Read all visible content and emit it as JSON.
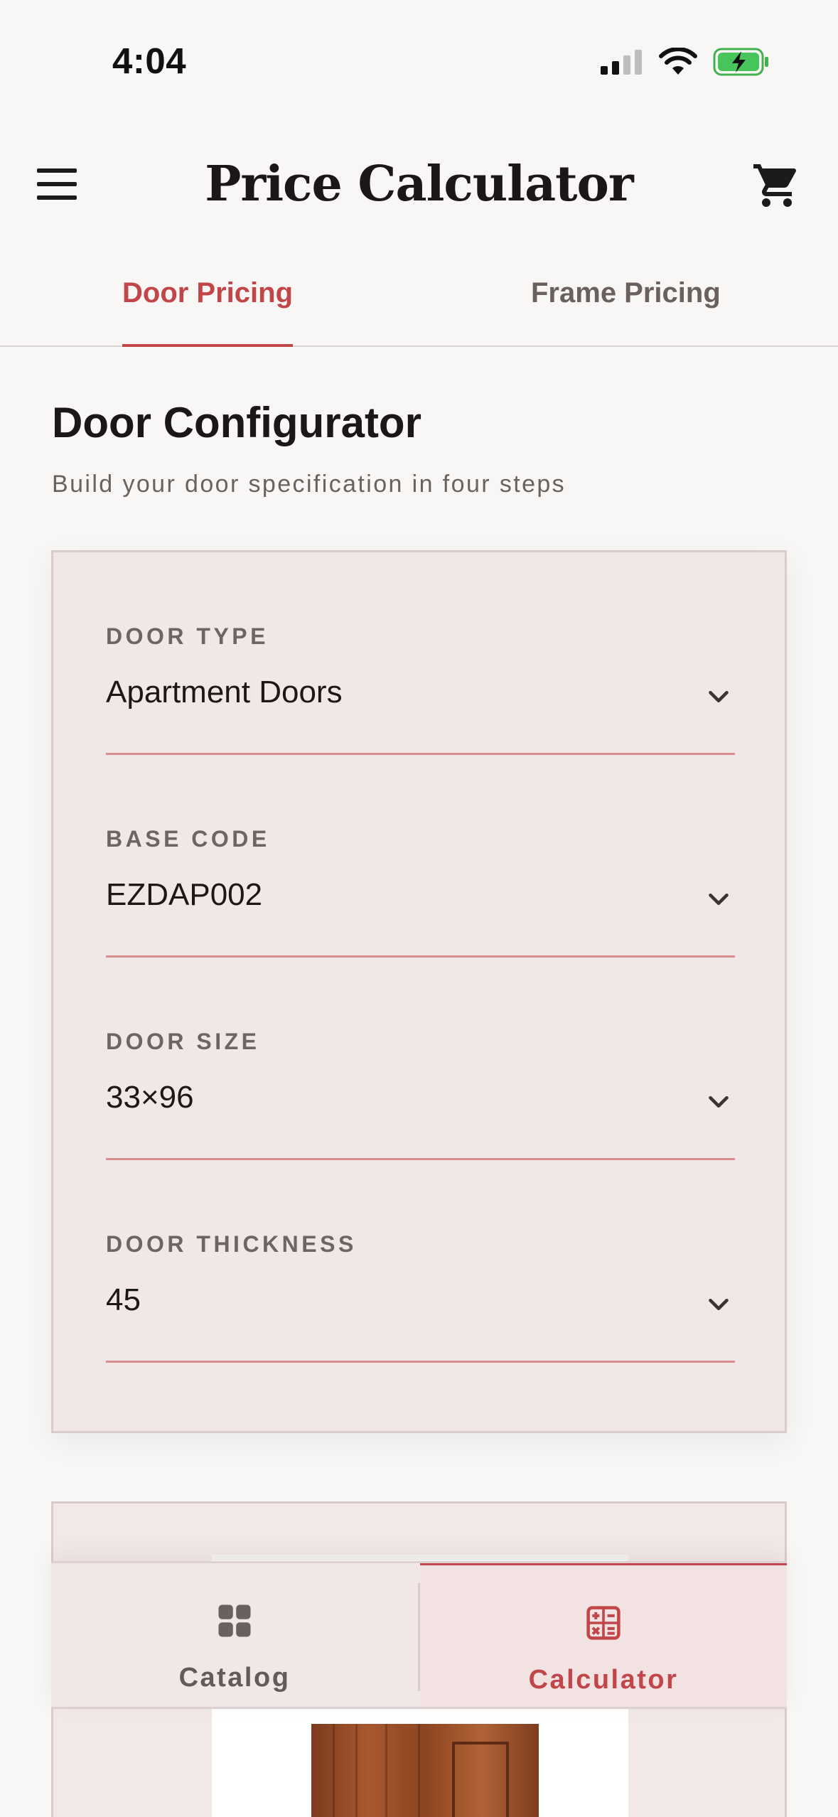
{
  "status_bar": {
    "time": "4:04",
    "icons": [
      "signal-icon",
      "wifi-icon",
      "battery-charging-icon"
    ]
  },
  "header": {
    "title": "Price Calculator",
    "menu_icon": "menu-icon",
    "cart_icon": "cart-icon"
  },
  "tabs": [
    {
      "label": "Door Pricing",
      "active": true
    },
    {
      "label": "Frame Pricing",
      "active": false
    }
  ],
  "configurator": {
    "title": "Door Configurator",
    "subtitle": "Build your door specification in four steps",
    "fields": [
      {
        "label": "DOOR TYPE",
        "value": "Apartment Doors"
      },
      {
        "label": "BASE CODE",
        "value": "EZDAP002"
      },
      {
        "label": "DOOR SIZE",
        "value": "33×96"
      },
      {
        "label": "DOOR THICKNESS",
        "value": "45"
      }
    ]
  },
  "bottom_nav": {
    "items": [
      {
        "label": "Catalog",
        "icon": "grid-icon",
        "active": false
      },
      {
        "label": "Calculator",
        "icon": "calculator-icon",
        "active": true
      }
    ]
  },
  "colors": {
    "accent": "#c1464a",
    "card_background": "#f1e7e6",
    "page_background": "#f9f7f6"
  }
}
